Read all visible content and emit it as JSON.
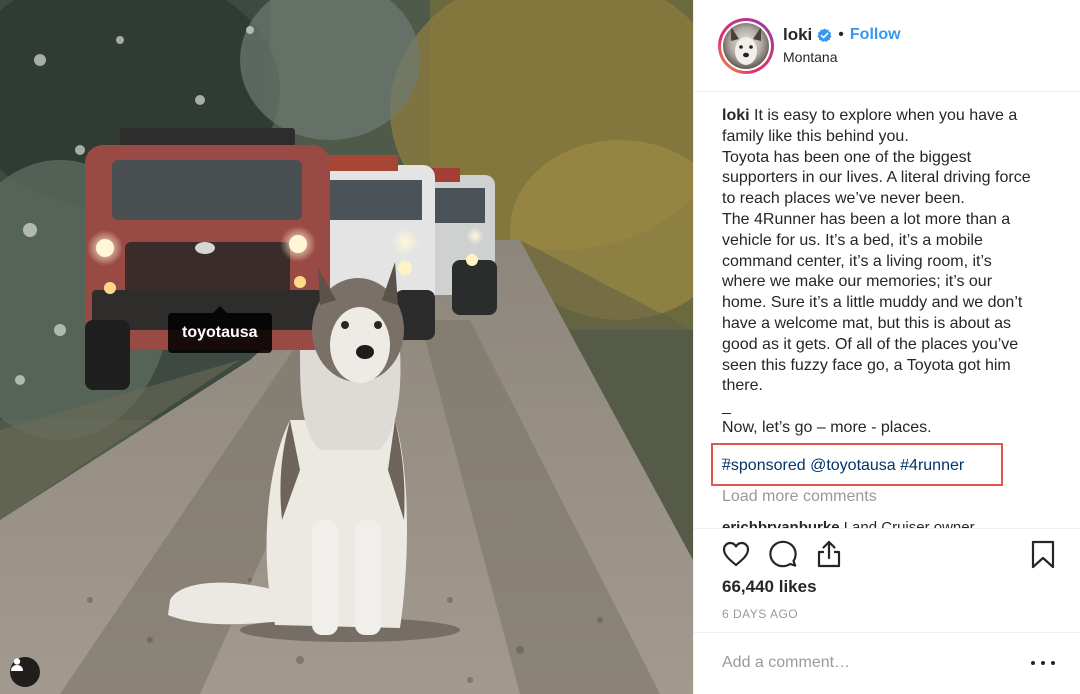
{
  "photo": {
    "tag_label": "toyotausa",
    "tag_icon": "user-icon"
  },
  "header": {
    "username": "loki",
    "verified_icon": "verified-badge-icon",
    "separator": "•",
    "follow_label": "Follow",
    "location": "Montana"
  },
  "caption": {
    "username": "loki",
    "lines": [
      " It is easy to explore when you have a",
      "family like this behind you.",
      "Toyota has been one of the biggest",
      "supporters in our lives. A literal driving force",
      "to reach places we’ve never been.",
      "The 4Runner has been a lot more than a",
      "vehicle for us. It’s a bed, it’s a mobile",
      "command center, it’s a living room, it’s",
      "where we make our memories; it’s our",
      "home. Sure it’s a little muddy and we don’t",
      "have a welcome mat, but this is about as",
      "good as it gets. Of all of the places you’ve",
      "seen this fuzzy face go, a Toyota got him",
      "there."
    ],
    "dash1": "_",
    "closing": "Now, let’s go – more - places.",
    "dash2": "_",
    "hashtags": [
      "#sponsored",
      "@toyotausa",
      "#4runner"
    ]
  },
  "comments": {
    "load_more": "Load more comments",
    "peek_user": "erichbryanburke",
    "peek_text": " Land Cruiser owner"
  },
  "actions": {
    "like_icon": "heart-icon",
    "comment_icon": "comment-icon",
    "share_icon": "share-icon",
    "save_icon": "bookmark-icon"
  },
  "stats": {
    "likes": "66,440 likes",
    "time": "6 DAYS AGO"
  },
  "comment_box": {
    "placeholder": "Add a comment…",
    "more_icon": "more-options-icon"
  }
}
